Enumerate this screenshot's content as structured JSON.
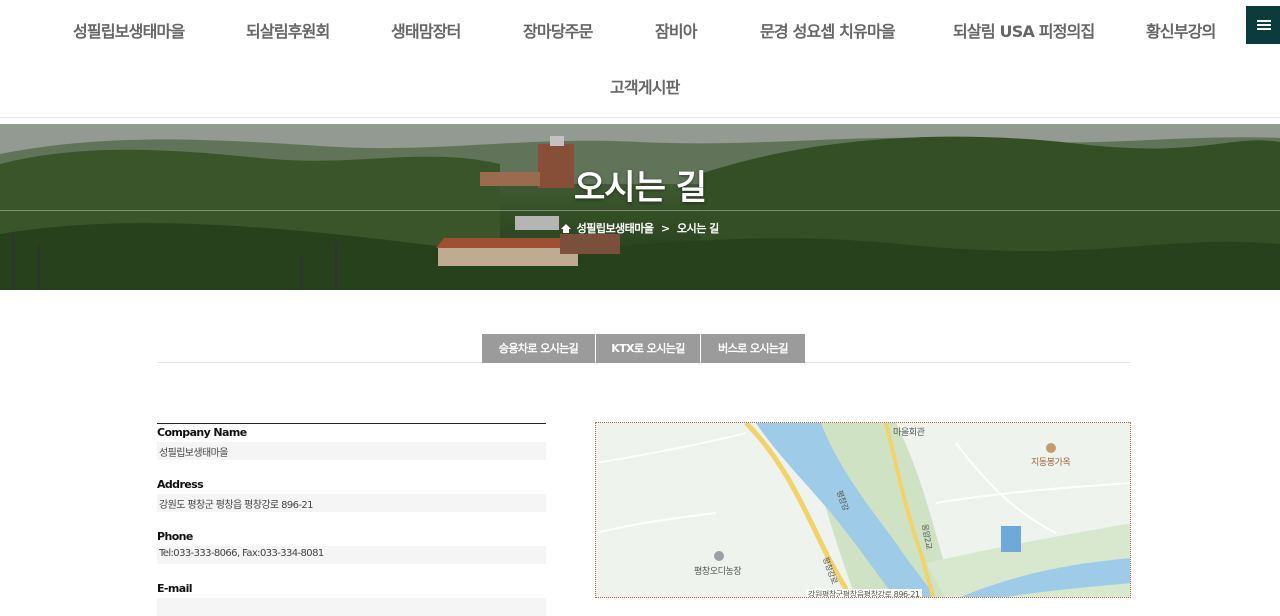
{
  "nav": {
    "items": [
      {
        "label": "성필립보생태마을"
      },
      {
        "label": "되살림후원회"
      },
      {
        "label": "생태맘장터"
      },
      {
        "label": "장마당주문"
      },
      {
        "label": "잠비아"
      },
      {
        "label": "문경 성요셉 치유마을"
      },
      {
        "label": "되살림 USA 피정의집"
      },
      {
        "label": "황신부강의"
      },
      {
        "label": "고객게시판"
      }
    ]
  },
  "banner": {
    "title": "오시는 길",
    "breadcrumb": [
      "성필립보생태마을",
      "오시는 길"
    ],
    "breadcrumb_separator": ">"
  },
  "tabs": [
    {
      "label": "승용차로 오시는길"
    },
    {
      "label": "KTX로 오시는길"
    },
    {
      "label": "버스로 오시는길"
    }
  ],
  "info": {
    "company_label": "Company Name",
    "company_value": "성필립보생태마을",
    "address_label": "Address",
    "address_value": "강원도 평창군 평창읍 평창강로 896-21",
    "phone_label": "Phone",
    "phone_value": "Tel:033-333-8066, Fax:033-334-8081",
    "email_label": "E-mail"
  },
  "map": {
    "labels": {
      "village_hall": "마을회관",
      "restaurant": "지동봉가옥",
      "farm": "평창오디농장",
      "river": "평창강",
      "road1": "평창강로",
      "road2": "응암2교",
      "address_marker": "강원평창군평창읍평창강로 896-21"
    }
  },
  "colors": {
    "menu_button": "#0b3b3d",
    "tab_bg": "#9b9b9b",
    "map_border": "#b26b4a"
  }
}
